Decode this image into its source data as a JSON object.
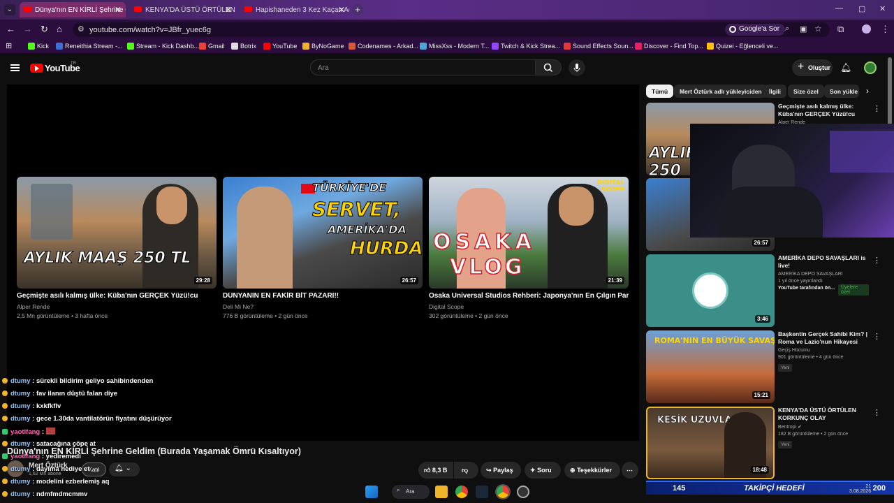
{
  "browser": {
    "tabs": [
      {
        "title": "Dünya'nın EN KİRLİ Şehrine Gel",
        "active": true
      },
      {
        "title": "KENYA'DA ÜSTÜ ÖRTÜLEN KOF",
        "active": false
      },
      {
        "title": "Hapishaneden 3 Kez Kaçan Ada",
        "active": false
      }
    ],
    "url": "youtube.com/watch?v=JBfr_yuec6g",
    "google_lens": "Google'a Sor",
    "bookmarks": [
      "Kick",
      "Reneithia Stream -...",
      "Stream - Kick Dashb...",
      "Gmail",
      "Botrix",
      "YouTube",
      "ByNoGame",
      "Codenames - Arkad...",
      "MissXss - Modern T...",
      "Twitch & Kick Strea...",
      "Sound Effects Soun...",
      "Discover - Find Top...",
      "Quizei - Eğlenceli ve..."
    ]
  },
  "youtube": {
    "logo": "YouTube",
    "logo_sup": "TR",
    "search_placeholder": "Ara",
    "create_label": "Oluştur"
  },
  "endscreen": [
    {
      "title": "Geçmişte asılı kalmış ülke: Küba'nın GERÇEK Yüzü!cu",
      "channel": "Alper Rende",
      "meta": "2,5 Mn görüntüleme • 3 hafta önce",
      "duration": "29:28",
      "overlay": "AYLIK MAAŞ 250 TL"
    },
    {
      "title": "DÜNYANIN EN FAKİR BİT PAZARI!!",
      "channel": "Deli Mi Ne?",
      "meta": "776 B görüntüleme • 2 gün önce",
      "duration": "26:57",
      "overlay1": "TÜRKİYE'DE",
      "overlay2": "SERVET,",
      "overlay3": "AMERİKA'DA",
      "overlay4": "HURDA"
    },
    {
      "title": "Osaka Universal Studios Rehberi: Japonya'nın En Çılgın Parkı!",
      "channel": "Digital Scope",
      "meta": "302 görüntüleme • 2 gün önce",
      "duration": "21:39",
      "overlay1": "OSAKA",
      "overlay2": "VLOG",
      "badge": "DIGITAL SCOPE"
    }
  ],
  "video": {
    "title": "Dünya'nın EN KİRLİ Şehrine Geldim (Burada Yaşamak Ömrü Kısaltıyor)",
    "channel": "Mert Öztürk",
    "subs": "1,62 Mn abone",
    "join": "Katıl",
    "likes": "8,3 B",
    "share": "Paylaş",
    "ask": "Soru",
    "thanks": "Teşekkürler"
  },
  "chat": [
    {
      "user": "dtumy",
      "text": ": sürekli bildirim geliyo sahibindenden"
    },
    {
      "user": "dtumy",
      "text": ": fav ilanın düştü falan diye"
    },
    {
      "user": "dtumy",
      "text": ": kxkfkflv"
    },
    {
      "user": "dtumy",
      "text": ": gece 1.30da vantilatörün fiyatını düşürüyor"
    },
    {
      "user": "yaotlfang",
      "text": ":"
    },
    {
      "user": "dtumy",
      "text": ": satacağına çöpe at"
    },
    {
      "user": "yaotlfang",
      "text": ": yediremedi"
    },
    {
      "user": "dtumy",
      "text": ": dayıma hediye et"
    },
    {
      "user": "dtumy",
      "text": ": modelini ezberlemiş aq"
    },
    {
      "user": "dtumy",
      "text": ": ndmfmdmcmmv"
    }
  ],
  "chips": [
    "Tümü",
    "Mert Öztürk adlı yükleyiciden",
    "İlgili",
    "Size özel",
    "Son yükle"
  ],
  "sidebar": [
    {
      "title": "Geçmişte asılı kalmış ülke: Küba'nın GERÇEK Yüzü!cu",
      "channel": "Alper Rende",
      "meta": "",
      "duration": ""
    },
    {
      "title": "",
      "channel": "",
      "meta": "",
      "duration": "26:57"
    },
    {
      "title": "AMERİKA DEPO SAVAŞLARI is live!",
      "channel": "AMERİKA DEPO SAVAŞLARI",
      "meta": "1 yıl önce yayınlandı",
      "extra": "YouTube tarafından ön...",
      "member": "Üyelere özel",
      "duration": "3:46"
    },
    {
      "title": "Başkentin Gerçek Sahibi Kim? | Roma ve Lazio'nun Hikayesi",
      "channel": "Geçiş Hücumu",
      "meta": "901 görüntüleme • 4 gün önce",
      "new": "Yeni",
      "duration": "15:21",
      "overlay": "ROMA'NIN EN BÜYÜK SAVAŞI"
    },
    {
      "title": "KENYA'DA ÜSTÜ ÖRTÜLEN KORKUNÇ OLAY",
      "channel": "Bentropi",
      "meta": "182 B görüntüleme • 2 gün önce",
      "new": "Yeni",
      "duration": "18:48",
      "overlay": "KESİK UZUVLAR"
    }
  ],
  "stream": {
    "goal_current": "145",
    "goal_label": "TAKİPÇİ HEDEFİ",
    "goal_target": "200"
  },
  "taskbar": {
    "search": "Ara",
    "time": "21",
    "date": "3.08.2026"
  }
}
